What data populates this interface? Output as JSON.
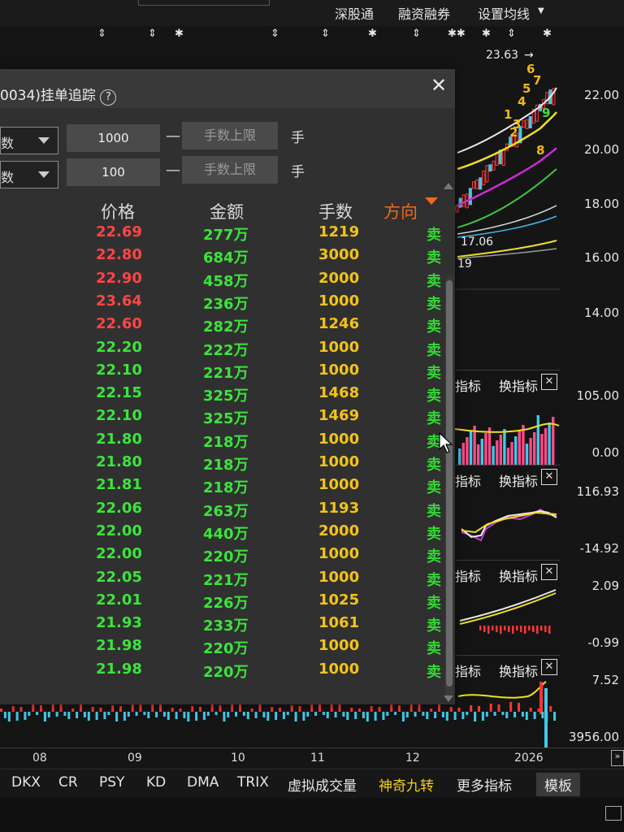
{
  "top_menu": {
    "items": [
      "深股通",
      "融资融券",
      "设置均线"
    ]
  },
  "markers": [
    "⇕",
    "⇕",
    "✱",
    "⇕",
    "⇕",
    "✱",
    "⇕",
    "✱✱",
    "✱",
    "⇕",
    "✱"
  ],
  "main_chart": {
    "high_label": "23.63",
    "ma_value_1": "17.06",
    "ma_value_2": "19",
    "wave_labels": [
      "1",
      "2",
      "3",
      "4",
      "5",
      "6",
      "7",
      "8",
      "9"
    ],
    "y_axis": [
      "22.00",
      "20.00",
      "18.00",
      "16.00",
      "14.00"
    ]
  },
  "panes": [
    {
      "title_partial": "指标",
      "switch_label": "换指标",
      "close_symbol": "✕",
      "axis_top": "105.00",
      "axis_bottom": "0.00"
    },
    {
      "title_partial": "指标",
      "switch_label": "换指标",
      "close_symbol": "✕",
      "axis_top": "116.93",
      "axis_bottom": "-14.92"
    },
    {
      "title_partial": "指标",
      "switch_label": "换指标",
      "close_symbol": "✕",
      "axis_top": "2.09",
      "axis_bottom": "-0.99"
    },
    {
      "title_partial": "指标",
      "switch_label": "换指标",
      "close_symbol": "✕",
      "axis_top": "7.52",
      "axis_bottom": "3956.00"
    }
  ],
  "dialog": {
    "title": "0034)挂单追踪",
    "help_icon": "?",
    "close_icon": "✕",
    "filters": [
      {
        "select_value": "数",
        "min_value": "1000",
        "max_placeholder": "手数上限",
        "unit": "手"
      },
      {
        "select_value": "数",
        "min_value": "100",
        "max_placeholder": "手数上限",
        "unit": "手"
      }
    ],
    "dash": "—",
    "columns": {
      "price": "价格",
      "amount": "金额",
      "volume": "手数",
      "direction": "方向"
    },
    "rows": [
      {
        "price": "22.69",
        "amount": "277万",
        "volume": "1219",
        "direction": "卖",
        "price_color": "#ff4545"
      },
      {
        "price": "22.80",
        "amount": "684万",
        "volume": "3000",
        "direction": "卖",
        "price_color": "#ff4545"
      },
      {
        "price": "22.90",
        "amount": "458万",
        "volume": "2000",
        "direction": "卖",
        "price_color": "#ff4545"
      },
      {
        "price": "23.64",
        "amount": "236万",
        "volume": "1000",
        "direction": "卖",
        "price_color": "#ff4545"
      },
      {
        "price": "22.60",
        "amount": "282万",
        "volume": "1246",
        "direction": "卖",
        "price_color": "#ff4545"
      },
      {
        "price": "22.20",
        "amount": "222万",
        "volume": "1000",
        "direction": "卖",
        "price_color": "#3ce43c"
      },
      {
        "price": "22.10",
        "amount": "221万",
        "volume": "1000",
        "direction": "卖",
        "price_color": "#3ce43c"
      },
      {
        "price": "22.15",
        "amount": "325万",
        "volume": "1468",
        "direction": "卖",
        "price_color": "#3ce43c"
      },
      {
        "price": "22.10",
        "amount": "325万",
        "volume": "1469",
        "direction": "卖",
        "price_color": "#3ce43c"
      },
      {
        "price": "21.80",
        "amount": "218万",
        "volume": "1000",
        "direction": "卖",
        "price_color": "#3ce43c"
      },
      {
        "price": "21.80",
        "amount": "218万",
        "volume": "1000",
        "direction": "卖",
        "price_color": "#3ce43c"
      },
      {
        "price": "21.81",
        "amount": "218万",
        "volume": "1000",
        "direction": "卖",
        "price_color": "#3ce43c"
      },
      {
        "price": "22.06",
        "amount": "263万",
        "volume": "1193",
        "direction": "卖",
        "price_color": "#3ce43c"
      },
      {
        "price": "22.00",
        "amount": "440万",
        "volume": "2000",
        "direction": "卖",
        "price_color": "#3ce43c"
      },
      {
        "price": "22.00",
        "amount": "220万",
        "volume": "1000",
        "direction": "卖",
        "price_color": "#3ce43c"
      },
      {
        "price": "22.05",
        "amount": "221万",
        "volume": "1000",
        "direction": "卖",
        "price_color": "#3ce43c"
      },
      {
        "price": "22.01",
        "amount": "226万",
        "volume": "1025",
        "direction": "卖",
        "price_color": "#3ce43c"
      },
      {
        "price": "21.93",
        "amount": "233万",
        "volume": "1061",
        "direction": "卖",
        "price_color": "#3ce43c"
      },
      {
        "price": "21.98",
        "amount": "220万",
        "volume": "1000",
        "direction": "卖",
        "price_color": "#3ce43c"
      },
      {
        "price": "21.98",
        "amount": "220万",
        "volume": "1000",
        "direction": "卖",
        "price_color": "#3ce43c"
      }
    ]
  },
  "x_axis": [
    "08",
    "09",
    "10",
    "11",
    "12",
    "2026"
  ],
  "bottom_tabs": [
    "DKX",
    "CR",
    "PSY",
    "KD",
    "DMA",
    "TRIX",
    "虚拟成交量",
    "神奇九转",
    "更多指标",
    "模板"
  ],
  "colors": {
    "up": "#ff4545",
    "down": "#3ce43c",
    "volume": "#f2c31a",
    "accent": "#f06a1e",
    "highlight_tab": "#f2d21a"
  }
}
